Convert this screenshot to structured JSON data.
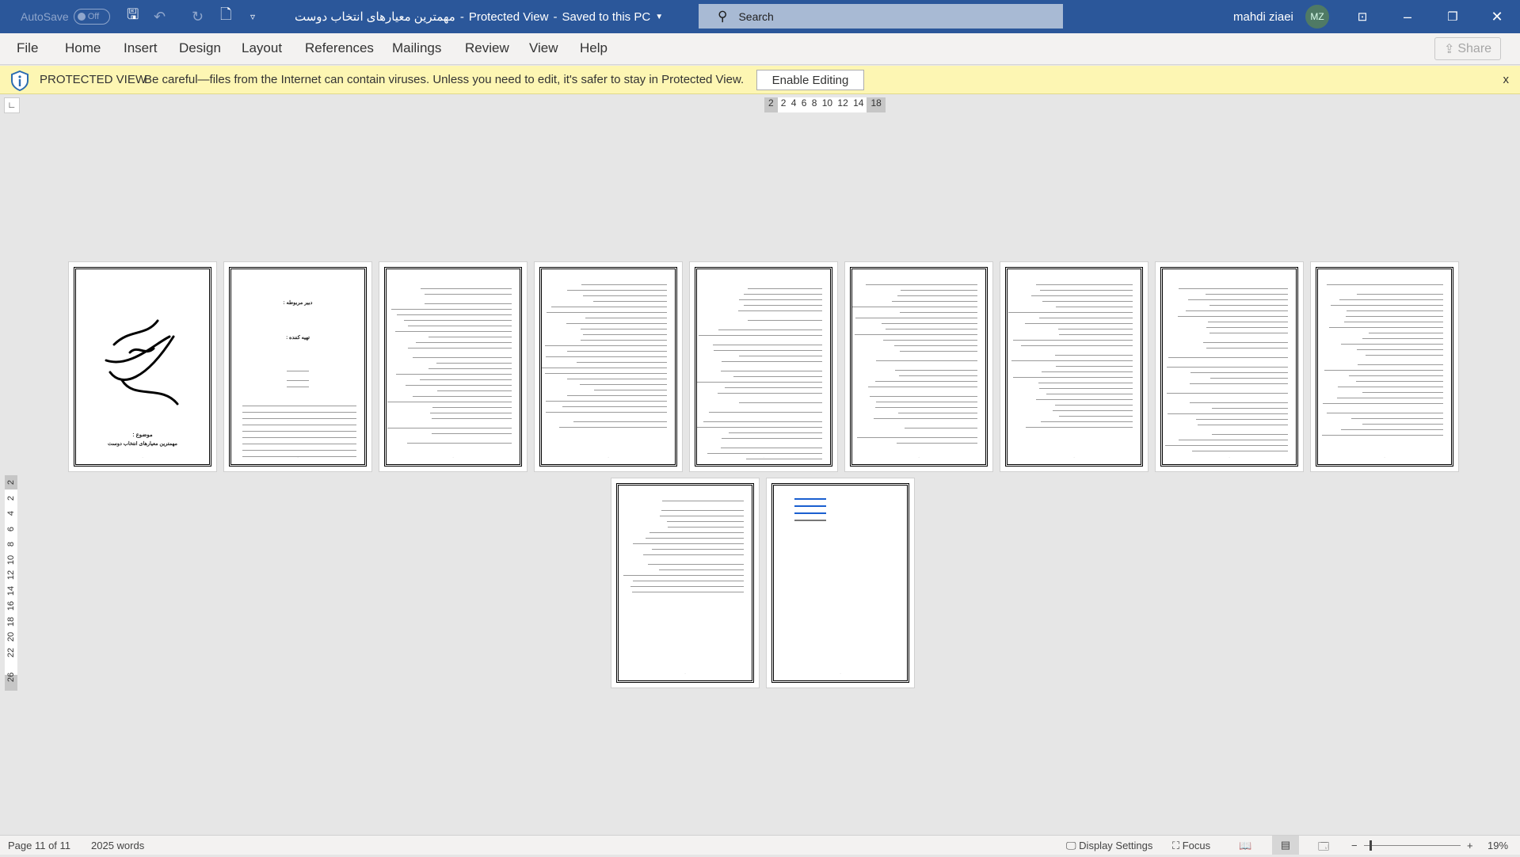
{
  "titlebar": {
    "autosave": "AutoSave",
    "autosave_state": "Off",
    "doc_title": "مهمترین معیارهای انتخاب دوست",
    "sep": "-",
    "mode": "Protected View",
    "save_state": "Saved to this PC",
    "search_placeholder": "Search",
    "user": "mahdi ziaei",
    "initials": "MZ"
  },
  "tabs": [
    "File",
    "Home",
    "Insert",
    "Design",
    "Layout",
    "References",
    "Mailings",
    "Review",
    "View",
    "Help"
  ],
  "share": "Share",
  "protected": {
    "label": "PROTECTED VIEW",
    "message": "Be careful—files from the Internet can contain viruses. Unless you need to edit, it's safer to stay in Protected View.",
    "button": "Enable Editing",
    "close": "x"
  },
  "ruler": {
    "left": "2",
    "marks": "2 4 6 8 10 12 14",
    "right": "18",
    "vertical": [
      "2",
      "2",
      "4",
      "6",
      "8",
      "10",
      "12",
      "14",
      "16",
      "18",
      "20",
      "22",
      "26"
    ]
  },
  "pages": {
    "p1": {
      "subject_label": "موضوع :",
      "subject": "مهمترین معیارهای انتخاب دوست"
    },
    "p2": {
      "teacher": "دبیر مربوطه :",
      "author": "تهیه کننده :"
    }
  },
  "status": {
    "page": "Page 11 of 11",
    "words": "2025 words",
    "display": "Display Settings",
    "focus": "Focus",
    "zoom": "19%"
  },
  "colors": {
    "titlebar": "#2b579a",
    "protected_bar": "#fdf6b3",
    "link": "#1a5fd0"
  }
}
